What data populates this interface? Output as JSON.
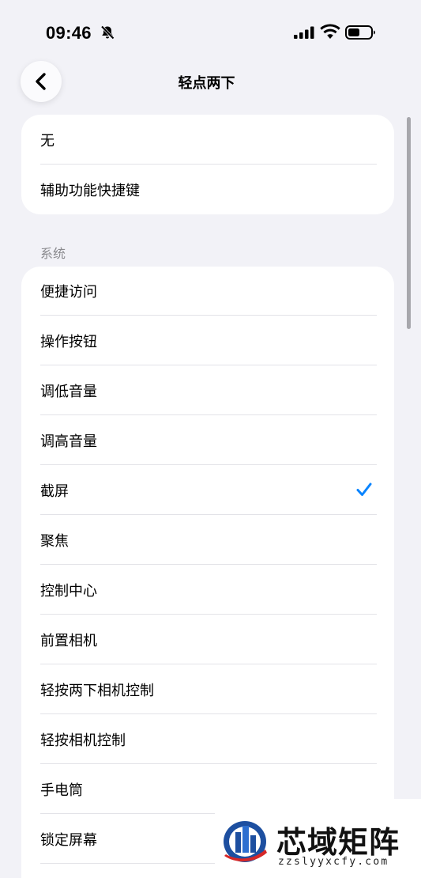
{
  "status_bar": {
    "time": "09:46"
  },
  "nav": {
    "title": "轻点两下"
  },
  "top_options": [
    {
      "label": "无"
    },
    {
      "label": "辅助功能快捷键"
    }
  ],
  "system_section": {
    "header": "系统",
    "items": [
      {
        "label": "便捷访问",
        "selected": false
      },
      {
        "label": "操作按钮",
        "selected": false
      },
      {
        "label": "调低音量",
        "selected": false
      },
      {
        "label": "调高音量",
        "selected": false
      },
      {
        "label": "截屏",
        "selected": true
      },
      {
        "label": "聚焦",
        "selected": false
      },
      {
        "label": "控制中心",
        "selected": false
      },
      {
        "label": "前置相机",
        "selected": false
      },
      {
        "label": "轻按两下相机控制",
        "selected": false
      },
      {
        "label": "轻按相机控制",
        "selected": false
      },
      {
        "label": "手电筒",
        "selected": false
      },
      {
        "label": "锁定屏幕",
        "selected": false
      }
    ]
  },
  "watermark": {
    "name": "芯域矩阵",
    "url": "zzslyyxcfy.com"
  },
  "colors": {
    "accent": "#0a84ff",
    "background": "#f2f2f7",
    "card": "#ffffff",
    "secondary_text": "#8a8a8e"
  }
}
